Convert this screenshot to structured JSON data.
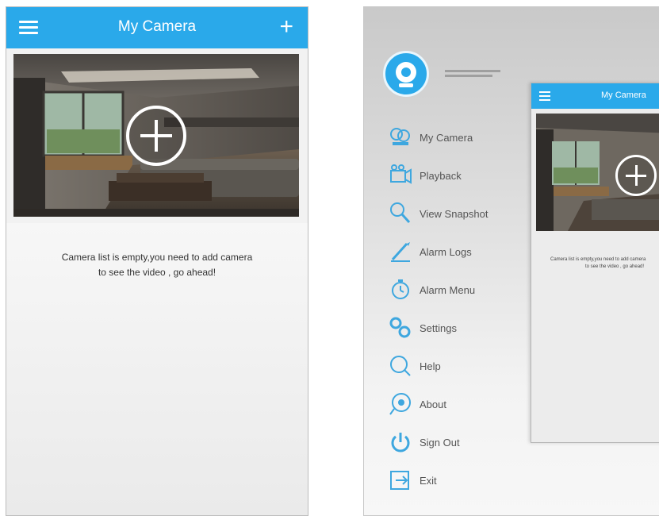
{
  "left_screen": {
    "header": {
      "title": "My Camera",
      "add_icon": "plus-icon",
      "menu_icon": "hamburger-icon"
    },
    "empty_message_line1": "Camera list is empty,you need to add camera",
    "empty_message_line2": "to see the video , go ahead!"
  },
  "right_screen": {
    "menu_items": [
      {
        "label": "My Camera",
        "icon": "cameras-icon"
      },
      {
        "label": "Playback",
        "icon": "playback-icon"
      },
      {
        "label": "View Snapshot",
        "icon": "snapshot-icon"
      },
      {
        "label": "Alarm Logs",
        "icon": "alarm-logs-icon"
      },
      {
        "label": "Alarm Menu",
        "icon": "alarm-menu-icon"
      },
      {
        "label": "Settings",
        "icon": "settings-icon"
      },
      {
        "label": "Help",
        "icon": "help-icon"
      },
      {
        "label": "About",
        "icon": "about-icon"
      },
      {
        "label": "Sign Out",
        "icon": "power-icon"
      },
      {
        "label": "Exit",
        "icon": "exit-icon"
      }
    ],
    "mini_app": {
      "title": "My Camera",
      "empty_message_line1": "Camera list is empty,you need to add camera",
      "empty_message_line2": "to see the video , go ahead!"
    }
  },
  "colors": {
    "accent": "#2aa9ea",
    "icon_blue": "#3ea7df",
    "text": "#333333"
  }
}
